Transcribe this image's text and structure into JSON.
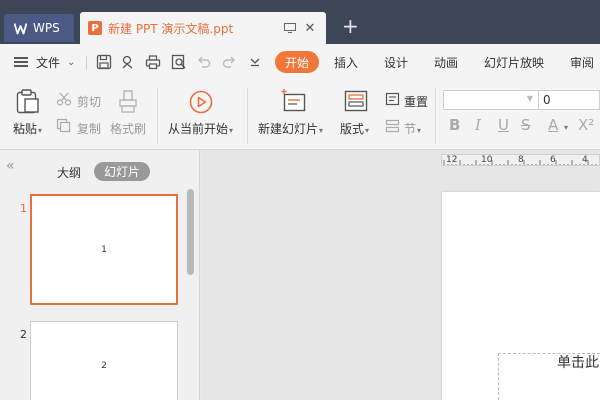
{
  "titlebar": {
    "home_tab": "WPS",
    "doc_tab": "新建 PPT 演示文稿.ppt",
    "doc_badge": "P",
    "close_glyph": "✕",
    "new_tab_glyph": "+"
  },
  "menubar": {
    "file_label": "文件",
    "tabs": [
      "开始",
      "插入",
      "设计",
      "动画",
      "幻灯片放映",
      "审阅"
    ],
    "active_tab": "开始",
    "accent_color": "#f0773a"
  },
  "ribbon": {
    "paste": "粘贴",
    "cut": "剪切",
    "copy": "复制",
    "format_painter": "格式刷",
    "play_from_current": "从当前开始",
    "new_slide": "新建幻灯片",
    "layout": "版式",
    "reset": "重置",
    "section": "节",
    "font_name": "",
    "font_size": "0",
    "format_buttons": [
      "B",
      "I",
      "U",
      "S",
      "A",
      "X²"
    ]
  },
  "left_panel": {
    "collapse_glyph": "«",
    "outline_tab": "大纲",
    "slides_tab": "幻灯片",
    "slides": [
      {
        "number": "1",
        "content": "1",
        "selected": true
      },
      {
        "number": "2",
        "content": "2",
        "selected": false
      }
    ]
  },
  "canvas": {
    "ruler_labels": [
      "12",
      "10",
      "8",
      "6",
      "4"
    ],
    "placeholder_text": "单击此"
  }
}
